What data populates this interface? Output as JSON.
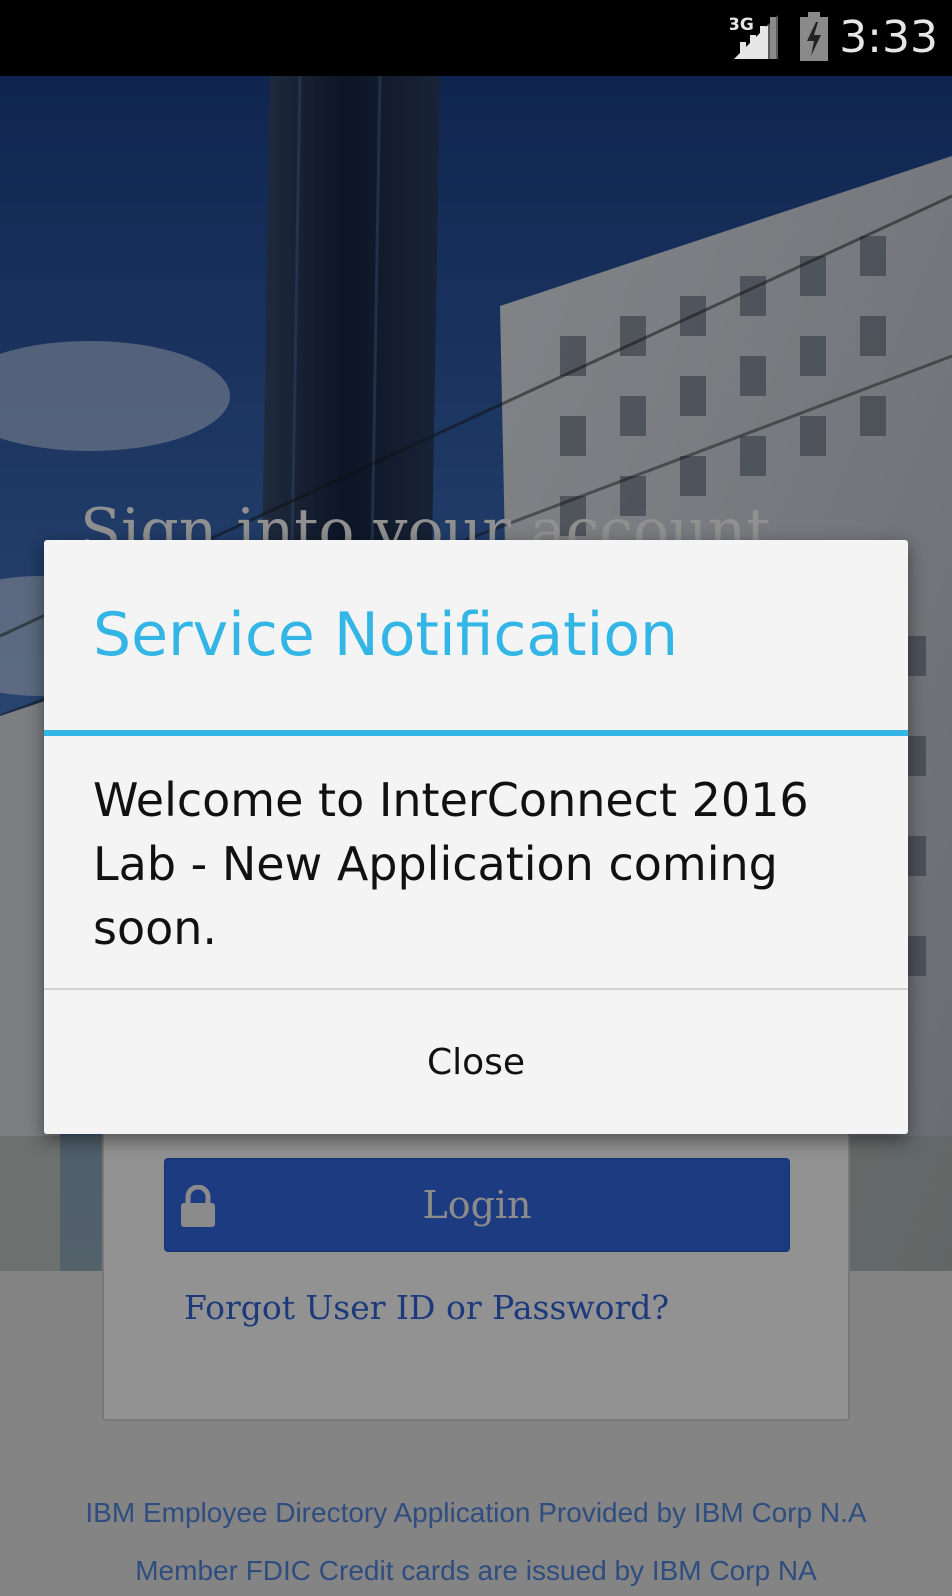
{
  "status_bar": {
    "network": "3G",
    "time": "3:33",
    "icons": [
      "signal-icon",
      "battery-charging-icon"
    ]
  },
  "login_screen": {
    "heading": "Sign into your account",
    "login_button": "Login",
    "forgot_link": "Forgot User ID or Password?",
    "footer_line_1": "IBM Employee Directory Application Provided by IBM Corp N.A",
    "footer_line_2": "Member FDIC Credit cards are issued by IBM Corp NA",
    "icons": [
      "lock-icon"
    ]
  },
  "dialog": {
    "title": "Service Notification",
    "message": "Welcome to InterConnect 2016 Lab - New Application coming soon.",
    "close_label": "Close"
  },
  "colors": {
    "accent": "#33b5e5",
    "login_button": "#2f63d6",
    "link": "#2f5fcf"
  }
}
